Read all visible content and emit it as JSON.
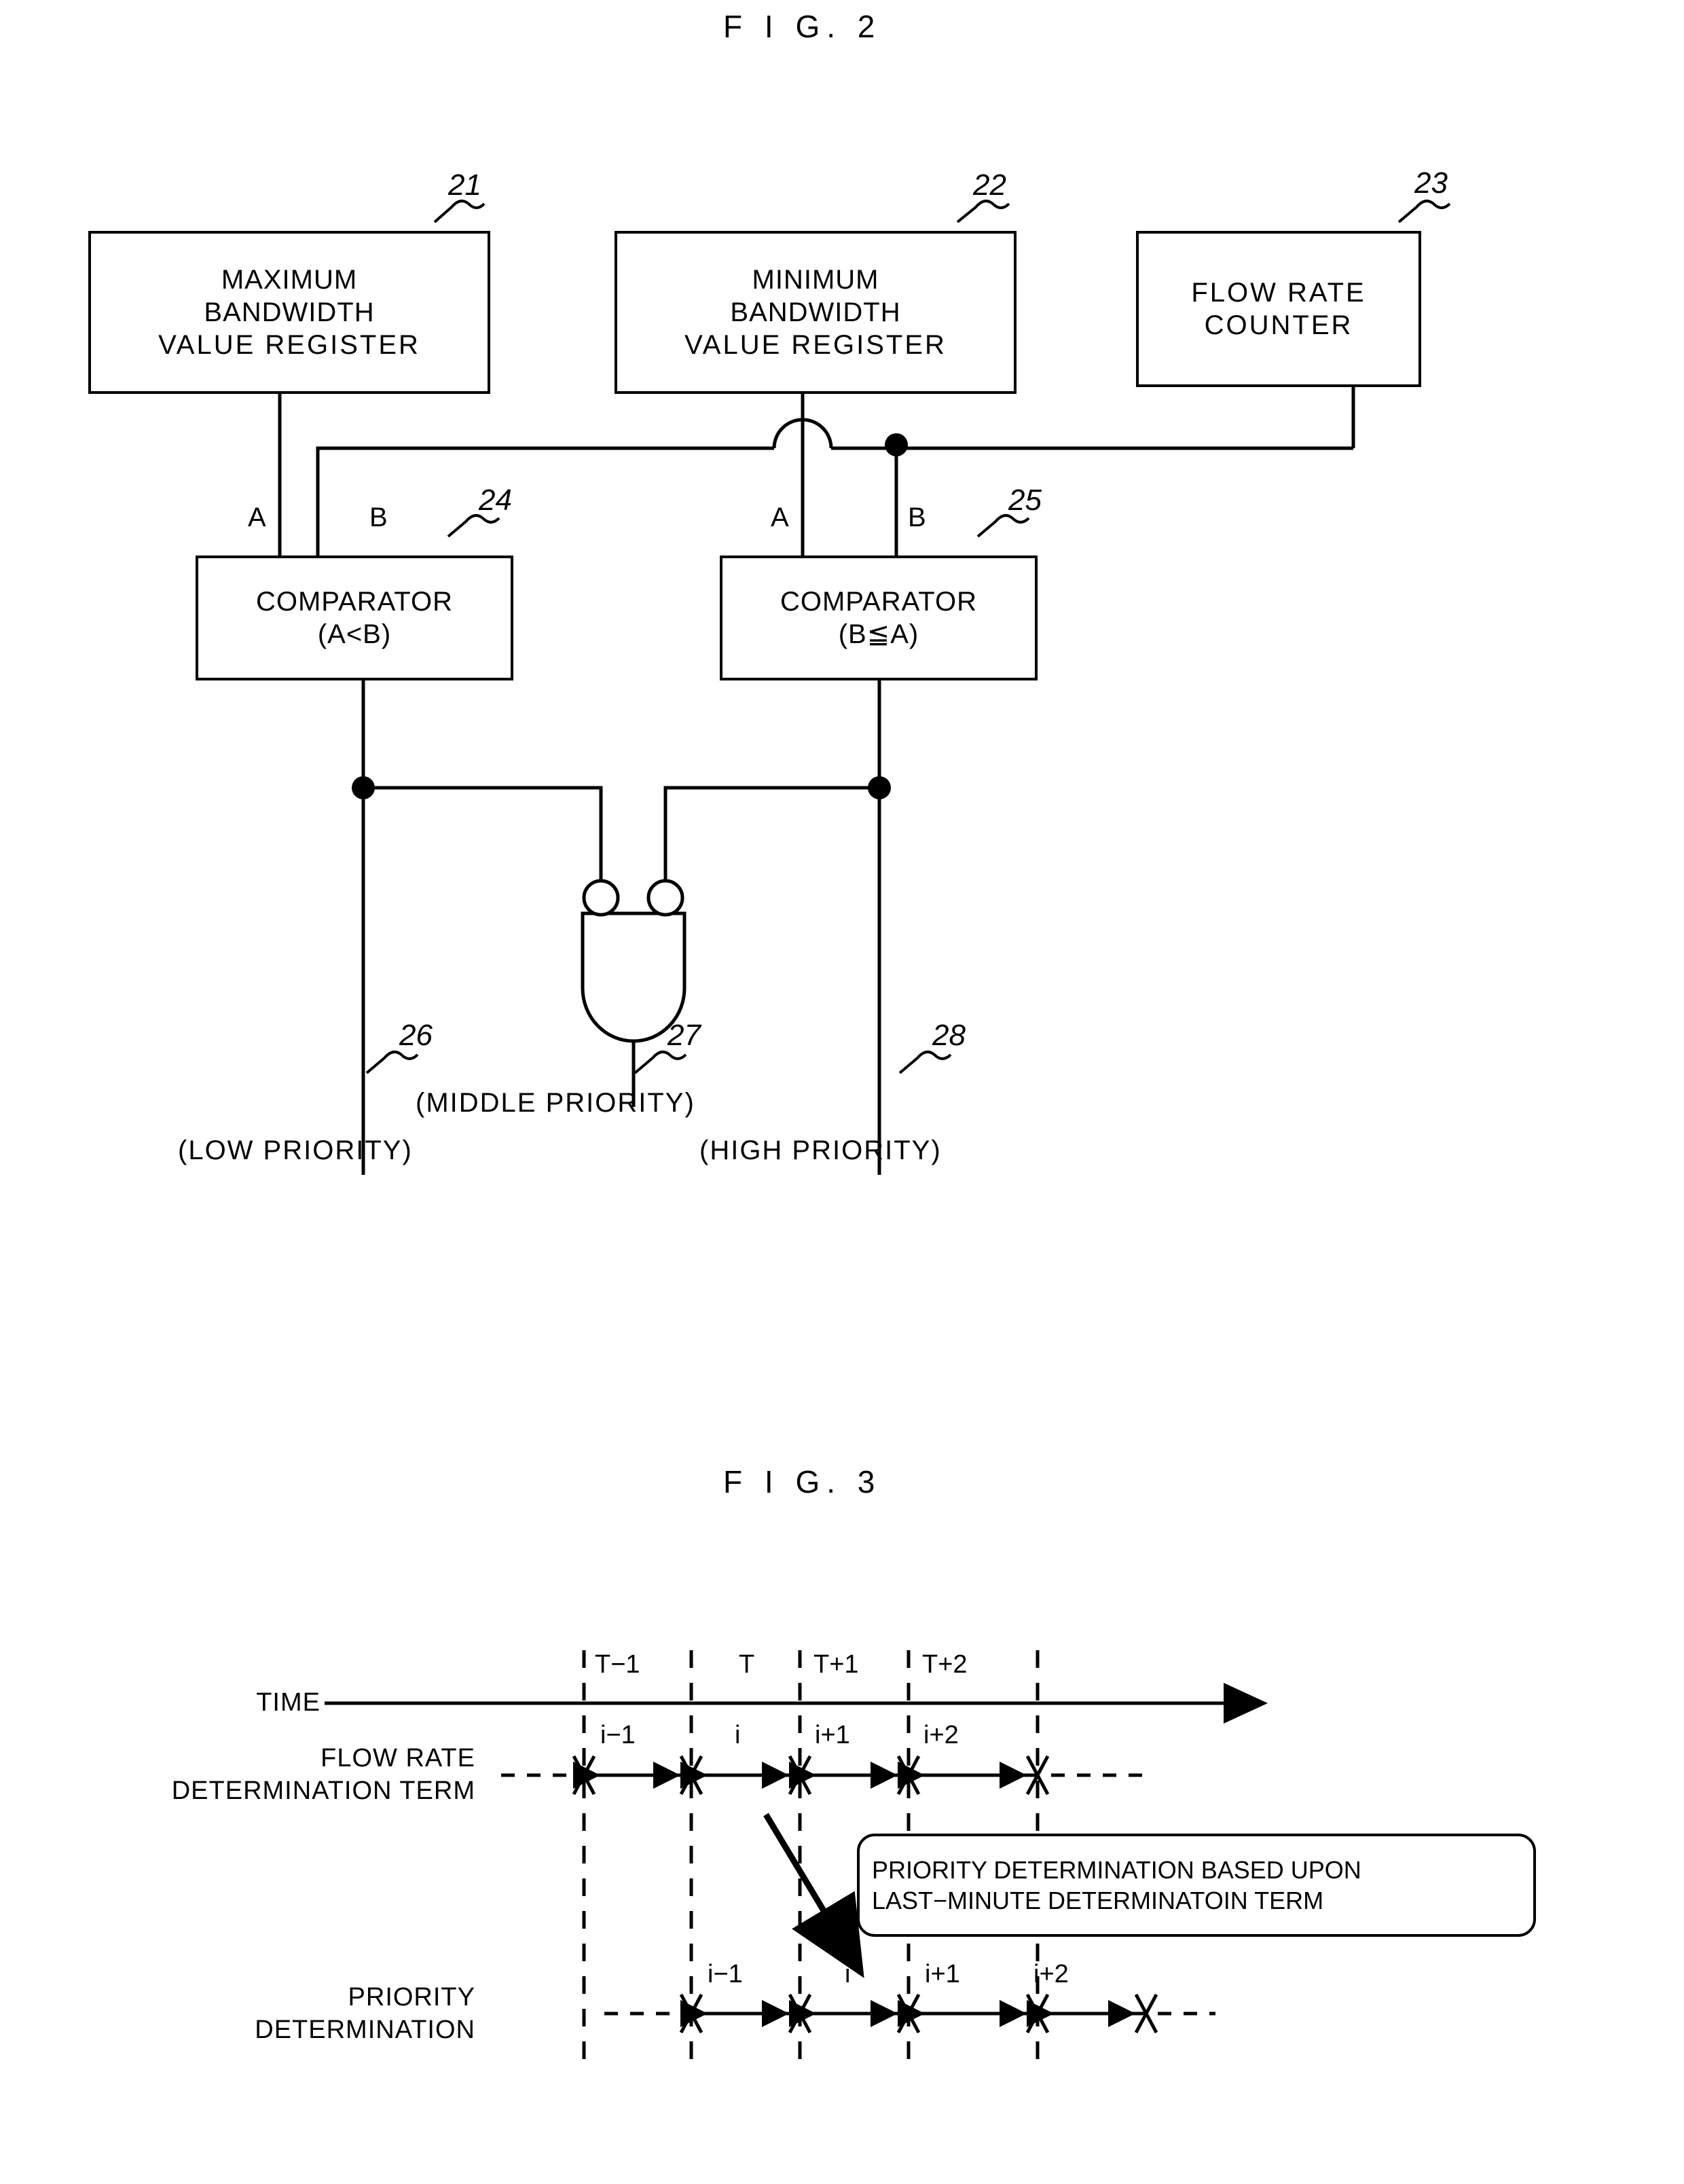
{
  "figures": {
    "fig2": {
      "title": "F I G. 2"
    },
    "fig3": {
      "title": "F I G. 3"
    }
  },
  "fig2": {
    "blocks": [
      {
        "ref": "21",
        "lines": [
          "MAXIMUM",
          "BANDWIDTH",
          "VALUE  REGISTER"
        ]
      },
      {
        "ref": "22",
        "lines": [
          "MINIMUM",
          "BANDWIDTH",
          "VALUE  REGISTER"
        ]
      },
      {
        "ref": "23",
        "lines": [
          "FLOW  RATE",
          "COUNTER"
        ]
      },
      {
        "ref": "24",
        "lines": [
          "COMPARATOR",
          "(A<B)"
        ]
      },
      {
        "ref": "25",
        "lines": [
          "COMPARATOR",
          "(B≦A)"
        ]
      }
    ],
    "pins": {
      "comp24_a": "A",
      "comp24_b": "B",
      "comp25_a": "A",
      "comp25_b": "B"
    },
    "outputs": [
      {
        "ref": "26",
        "label": "(LOW  PRIORITY)"
      },
      {
        "ref": "27",
        "label": "(MIDDLE  PRIORITY)"
      },
      {
        "ref": "28",
        "label": "(HIGH  PRIORITY)"
      }
    ],
    "gate": {
      "type": "and-gate-inverted-inputs",
      "inputs": 2
    }
  },
  "fig3": {
    "row_labels": {
      "time": "TIME",
      "flow_rate": [
        "FLOW RATE",
        "DETERMINATION TERM"
      ],
      "priority": [
        "PRIORITY",
        "DETERMINATION"
      ]
    },
    "time_ticks": [
      "T−1",
      "T",
      "T+1",
      "T+2"
    ],
    "flow_rate_terms": [
      "i−1",
      "i",
      "i+1",
      "i+2"
    ],
    "priority_terms": [
      "i−1",
      "i",
      "i+1",
      "i+2"
    ],
    "callout": [
      "PRIORITY DETERMINATION BASED UPON",
      "LAST−MINUTE DETERMINATOIN TERM"
    ]
  },
  "colors": {
    "ink": "#000000",
    "paper": "#ffffff"
  }
}
